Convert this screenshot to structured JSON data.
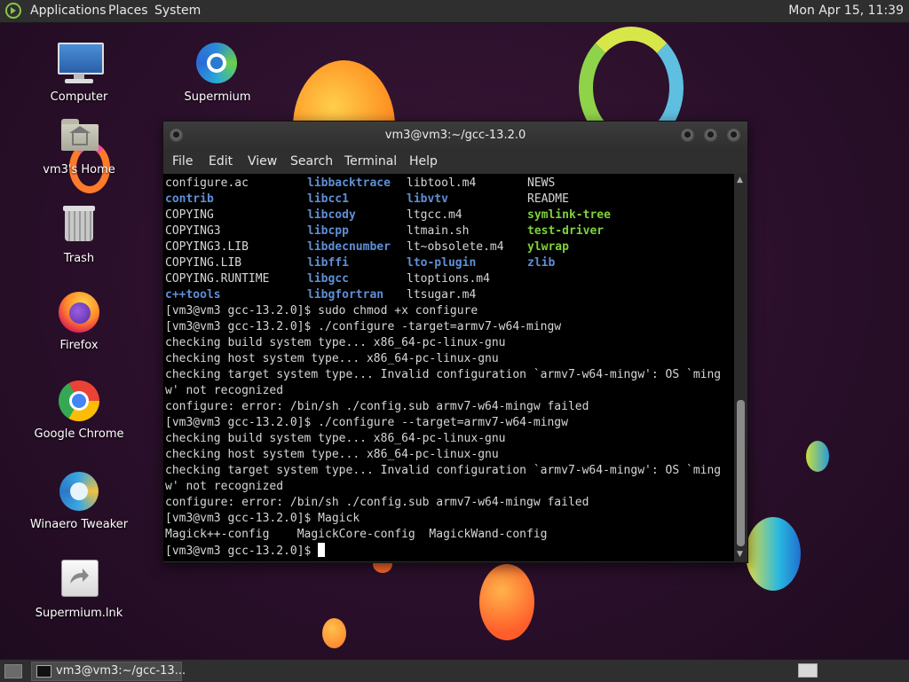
{
  "top_panel": {
    "menus": [
      "Applications",
      "Places",
      "System"
    ],
    "clock": "Mon Apr 15, 11:39"
  },
  "desktop_icons": [
    {
      "label": "Computer",
      "icon": "computer-icon"
    },
    {
      "label": "Supermium",
      "icon": "supermium-icon"
    },
    {
      "label": "vm3's Home",
      "icon": "home-folder-icon"
    },
    {
      "label": "Trash",
      "icon": "trash-icon"
    },
    {
      "label": "Firefox",
      "icon": "firefox-icon"
    },
    {
      "label": "Google Chrome",
      "icon": "chrome-icon"
    },
    {
      "label": "Winaero Tweaker",
      "icon": "winaero-tweaker-icon"
    },
    {
      "label": "Supermium.lnk",
      "icon": "shortcut-icon"
    }
  ],
  "terminal": {
    "title": "vm3@vm3:~/gcc-13.2.0",
    "menu": [
      "File",
      "Edit",
      "View",
      "Search",
      "Terminal",
      "Help"
    ],
    "listing": [
      [
        "configure.ac",
        "libbacktrace",
        "libtool.m4",
        "NEWS"
      ],
      [
        "contrib",
        "libcc1",
        "libvtv",
        "README"
      ],
      [
        "COPYING",
        "libcody",
        "ltgcc.m4",
        "symlink-tree"
      ],
      [
        "COPYING3",
        "libcpp",
        "ltmain.sh",
        "test-driver"
      ],
      [
        "COPYING3.LIB",
        "libdecnumber",
        "lt~obsolete.m4",
        "ylwrap"
      ],
      [
        "COPYING.LIB",
        "libffi",
        "lto-plugin",
        "zlib"
      ],
      [
        "COPYING.RUNTIME",
        "libgcc",
        "ltoptions.m4",
        ""
      ],
      [
        "c++tools",
        "libgfortran",
        "ltsugar.m4",
        ""
      ]
    ],
    "listing_styles": [
      [
        "plain",
        "dir",
        "plain",
        "plain"
      ],
      [
        "dir",
        "dir",
        "dir",
        "plain"
      ],
      [
        "plain",
        "dir",
        "plain",
        "exe"
      ],
      [
        "plain",
        "dir",
        "plain",
        "exe"
      ],
      [
        "plain",
        "dir",
        "plain",
        "exe"
      ],
      [
        "plain",
        "dir",
        "dir",
        "dir"
      ],
      [
        "plain",
        "dir",
        "plain",
        "plain"
      ],
      [
        "dir",
        "dir",
        "plain",
        "plain"
      ]
    ],
    "output_lines": [
      "[vm3@vm3 gcc-13.2.0]$ sudo chmod +x configure",
      "[vm3@vm3 gcc-13.2.0]$ ./configure -target=armv7-w64-mingw",
      "checking build system type... x86_64-pc-linux-gnu",
      "checking host system type... x86_64-pc-linux-gnu",
      "checking target system type... Invalid configuration `armv7-w64-mingw': OS `ming",
      "w' not recognized",
      "configure: error: /bin/sh ./config.sub armv7-w64-mingw failed",
      "[vm3@vm3 gcc-13.2.0]$ ./configure --target=armv7-w64-mingw",
      "checking build system type... x86_64-pc-linux-gnu",
      "checking host system type... x86_64-pc-linux-gnu",
      "checking target system type... Invalid configuration `armv7-w64-mingw': OS `ming",
      "w' not recognized",
      "configure: error: /bin/sh ./config.sub armv7-w64-mingw failed",
      "[vm3@vm3 gcc-13.2.0]$ Magick",
      "Magick++-config    MagickCore-config  MagickWand-config"
    ],
    "prompt": "[vm3@vm3 gcc-13.2.0]$ "
  },
  "taskbar": {
    "window_label": "vm3@vm3:~/gcc-13..."
  },
  "colors": {
    "dir": "#5f8fd6",
    "exe": "#7fd13b",
    "panel": "#2f2f2f"
  }
}
